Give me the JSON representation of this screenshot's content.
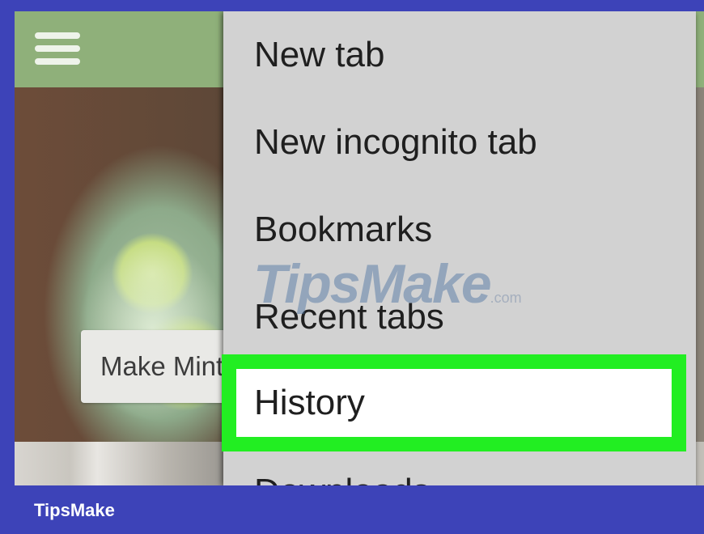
{
  "caption": {
    "text": "Make Mint"
  },
  "menu": {
    "items": [
      {
        "label": "New tab"
      },
      {
        "label": "New incognito tab"
      },
      {
        "label": "Bookmarks"
      },
      {
        "label": "Recent tabs"
      },
      {
        "label": "History"
      },
      {
        "label": "Downloads"
      }
    ],
    "highlighted_index": 4
  },
  "watermark": {
    "main": "TipsMake",
    "suffix": ".com"
  },
  "footer": {
    "brand": "TipsMake"
  },
  "icons": {
    "menu": "hamburger-icon"
  },
  "colors": {
    "toolbar": "#8fb07a",
    "menu_bg": "#d2d2d2",
    "highlight_border": "#22ee22",
    "frame": "#3d43b8"
  }
}
